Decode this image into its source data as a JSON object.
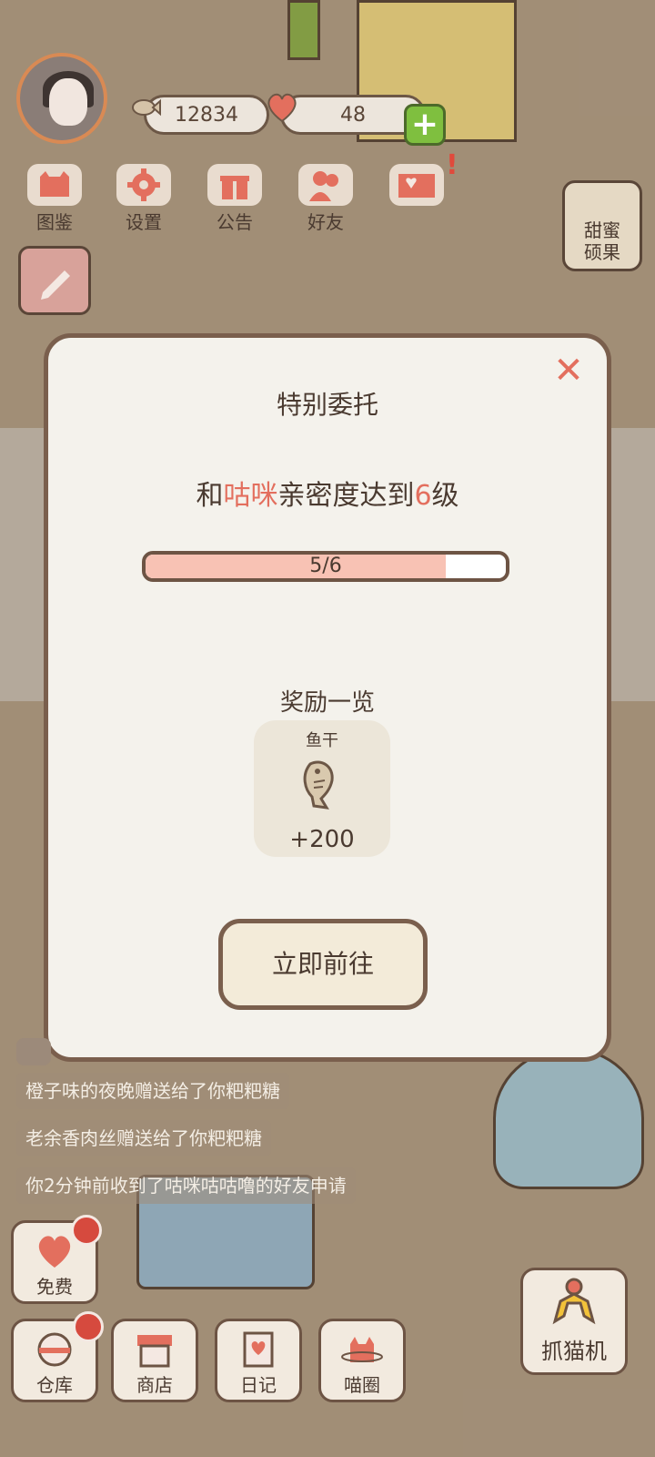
{
  "hud": {
    "fish_count": "12834",
    "heart_count": "48"
  },
  "menu": [
    {
      "label": "图鉴",
      "icon": "cat-book-icon"
    },
    {
      "label": "设置",
      "icon": "gear-icon"
    },
    {
      "label": "公告",
      "icon": "gift-icon"
    },
    {
      "label": "好友",
      "icon": "friends-icon"
    },
    {
      "label": "",
      "icon": "mail-icon"
    }
  ],
  "side": {
    "sweet_label_1": "甜蜜",
    "sweet_label_2": "硕果"
  },
  "modal": {
    "title": "特别委托",
    "task_prefix": "和",
    "task_cat": "咕咪",
    "task_mid": "亲密度达到",
    "task_level": "6",
    "task_suffix": "级",
    "progress_text": "5/6",
    "progress_fraction": 0.833,
    "rewards_title": "奖励一览",
    "reward_name": "鱼干",
    "reward_amount": "+200",
    "go_label": "立即前往",
    "close_icon": "close-icon"
  },
  "feed": [
    "橙子味的夜晚赠送给了你粑粑糖",
    "老余香肉丝赠送给了你粑粑糖",
    "你2分钟前收到了咕咪咕咕噜的好友申请"
  ],
  "bottom": {
    "free_label": "免费",
    "warehouse_label": "仓库",
    "shop_label": "商店",
    "diary_label": "日记",
    "circle_label": "喵圈",
    "claw_label": "抓猫机"
  },
  "colors": {
    "accent": "#e36f5e",
    "progress_fill": "#f8c2b4",
    "border": "#7a5f4d"
  }
}
